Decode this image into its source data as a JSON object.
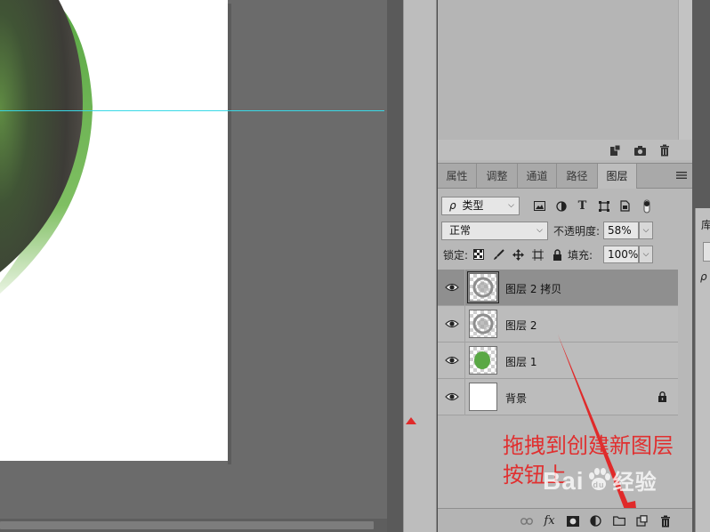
{
  "tabs": [
    {
      "label": "属性"
    },
    {
      "label": "调整"
    },
    {
      "label": "通道"
    },
    {
      "label": "路径"
    },
    {
      "label": "图层",
      "active": true
    }
  ],
  "filter": {
    "kind_label": "类型",
    "search_glyph": "ρ"
  },
  "blend": {
    "mode": "正常",
    "opacity_label": "不透明度:",
    "opacity_value": "58%"
  },
  "lock": {
    "label": "锁定:",
    "fill_label": "填充:",
    "fill_value": "100%"
  },
  "layers": [
    {
      "name": "图层 2 拷贝",
      "selected": true,
      "thumb": "grey-circle"
    },
    {
      "name": "图层 2",
      "selected": false,
      "thumb": "grey-circle"
    },
    {
      "name": "图层 1",
      "selected": false,
      "thumb": "green-circle"
    },
    {
      "name": "背景",
      "selected": false,
      "thumb": "white",
      "locked": true
    }
  ],
  "bottom_bar": {
    "fx_label": "fx"
  },
  "annotation": {
    "line1": "拖拽到创建新图层",
    "line2": "按钮上"
  },
  "watermark": {
    "brand": "Bai",
    "brand2": "du",
    "suffix": "经验"
  },
  "edge_panel": {
    "char": "库"
  },
  "colors": {
    "accent_red": "#e03030",
    "guide_cyan": "#39d9e6",
    "green_rim": "#5aa845",
    "panel_bg": "#b8b8b8"
  },
  "icons": [
    "eye-icon",
    "lock-icon",
    "link-icon",
    "mask-icon",
    "folder-icon",
    "new-layer-icon",
    "trash-icon",
    "camera-icon",
    "adjustment-icon"
  ]
}
